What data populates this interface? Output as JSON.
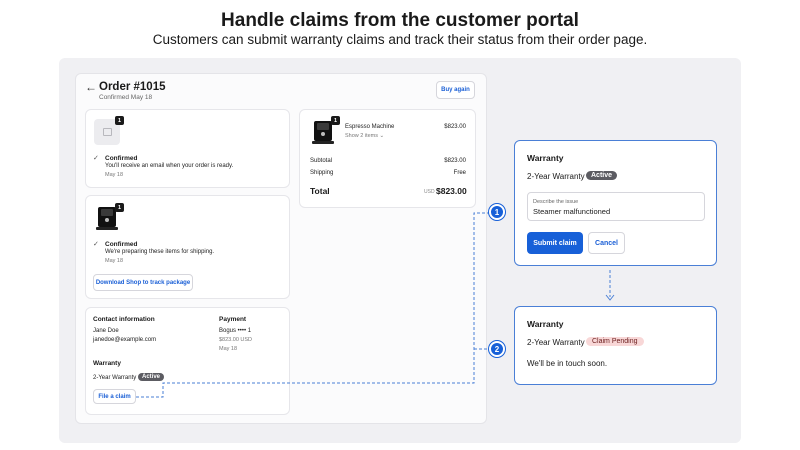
{
  "header": {
    "title": "Handle claims from the customer portal",
    "subtitle": "Customers can submit warranty claims and track their status from their order page."
  },
  "order": {
    "back_icon": "←",
    "title": "Order #1015",
    "confirmed_date": "Confirmed May 18",
    "buy_again_label": "Buy again"
  },
  "shipment1": {
    "qty": "1",
    "status": "Confirmed",
    "message": "You'll receive an email when your order is ready.",
    "date": "May 18"
  },
  "shipment2": {
    "qty": "1",
    "status": "Confirmed",
    "message": "We're preparing these items for shipping.",
    "date": "May 18",
    "download_label": "Download Shop to track package"
  },
  "summary": {
    "qty": "1",
    "item_name": "Espresso Machine",
    "item_sub": "Show 2 items",
    "item_price": "$823.00",
    "subtotal_label": "Subtotal",
    "subtotal_value": "$823.00",
    "shipping_label": "Shipping",
    "shipping_value": "Free",
    "total_label": "Total",
    "currency": "USD",
    "total_value": "$823.00"
  },
  "details": {
    "contact_heading": "Contact information",
    "name": "Jane Doe",
    "email": "janedoe@example.com",
    "payment_heading": "Payment",
    "card": "Bogus •••• 1",
    "amount": "$823.00 USD",
    "payment_date": "May 18",
    "warranty_heading": "Warranty",
    "warranty_name": "2-Year Warranty",
    "warranty_status": "Active",
    "file_claim_label": "File a claim"
  },
  "claim_form": {
    "title": "Warranty",
    "warranty_name": "2-Year Warranty",
    "status": "Active",
    "field_label": "Describe the issue",
    "field_value": "Steamer malfunctioned",
    "submit_label": "Submit claim",
    "cancel_label": "Cancel"
  },
  "claim_status": {
    "title": "Warranty",
    "warranty_name": "2-Year Warranty",
    "status": "Claim Pending",
    "message": "We'll be in touch soon."
  },
  "steps": [
    "1",
    "2"
  ],
  "colors": {
    "accent": "#1760d8",
    "active_badge": "#5c5c62",
    "pending_badge": "#f8d7d7"
  }
}
